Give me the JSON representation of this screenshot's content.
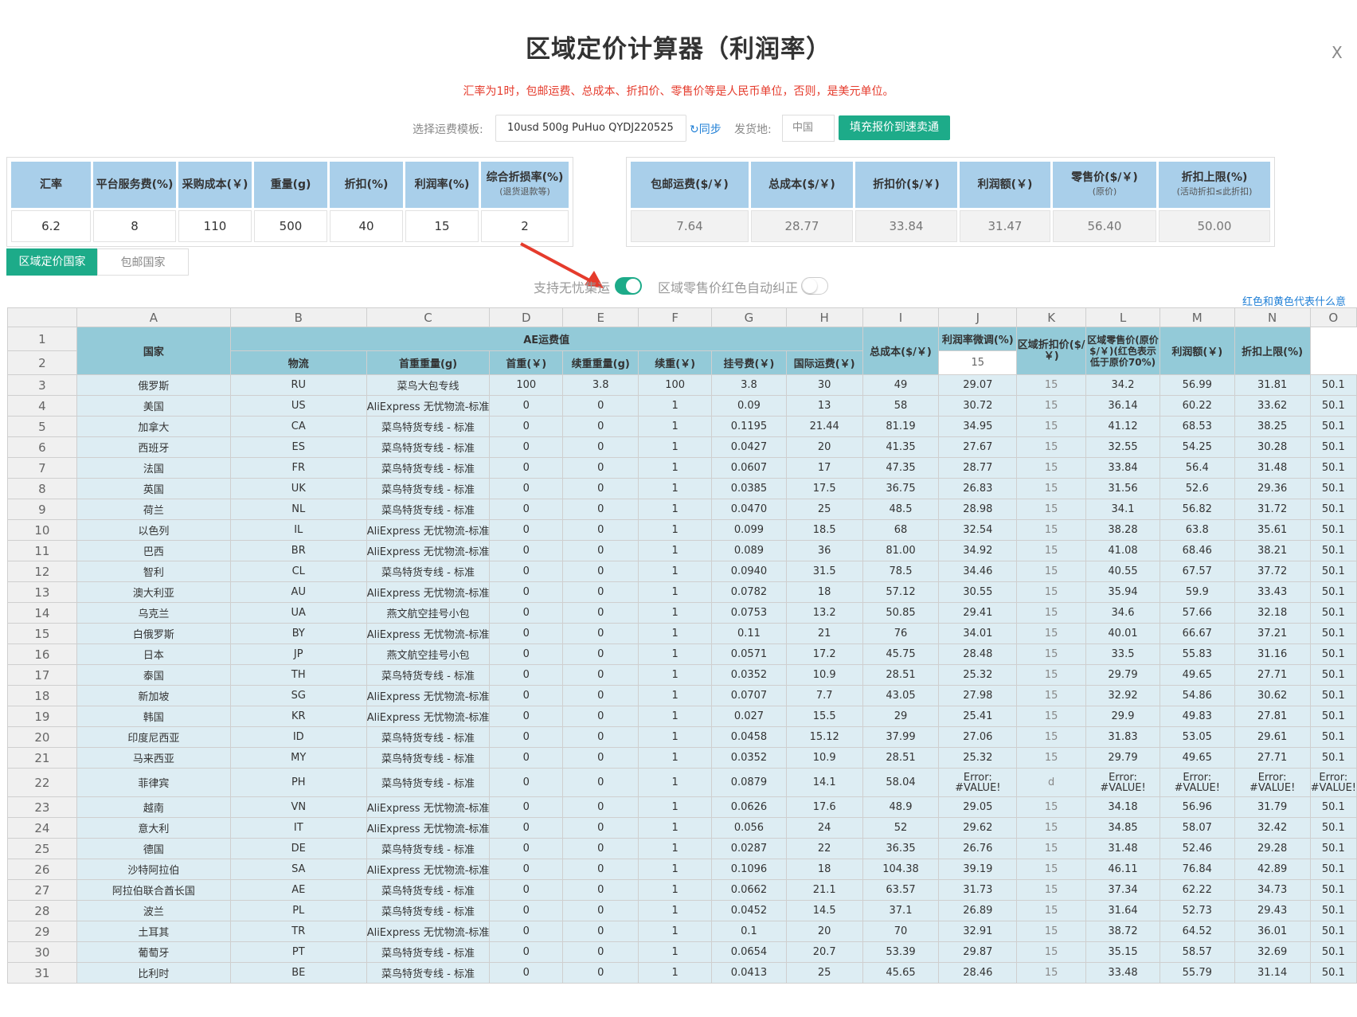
{
  "title": "区域定价计算器（利润率）",
  "close": "X",
  "notice": "汇率为1时，包邮运费、总成本、折扣价、零售价等是人民币单位，否则，是美元单位。",
  "template": {
    "label": "选择运费模板:",
    "selected": "10usd 500g PuHuo QYDJ220525",
    "sync": "↻同步",
    "ship_from_label": "发货地:",
    "ship_from_value": "中国",
    "fill_button": "填充报价到速卖通"
  },
  "inputs": [
    {
      "label": "汇率",
      "sub": "",
      "value": "6.2"
    },
    {
      "label": "平台服务费(%)",
      "sub": "",
      "value": "8"
    },
    {
      "label": "采购成本(￥)",
      "sub": "",
      "value": "110"
    },
    {
      "label": "重量(g)",
      "sub": "",
      "value": "500"
    },
    {
      "label": "折扣(%)",
      "sub": "",
      "value": "40"
    },
    {
      "label": "利润率(%)",
      "sub": "",
      "value": "15"
    },
    {
      "label": "综合折损率(%)",
      "sub": "(退货退款等)",
      "value": "2"
    }
  ],
  "outputs": [
    {
      "label": "包邮运费($/￥)",
      "sub": "",
      "value": "7.64"
    },
    {
      "label": "总成本($/￥)",
      "sub": "",
      "value": "28.77"
    },
    {
      "label": "折扣价($/￥)",
      "sub": "",
      "value": "33.84"
    },
    {
      "label": "利润额(￥)",
      "sub": "",
      "value": "31.47"
    },
    {
      "label": "零售价($/￥)",
      "sub": "(原价)",
      "value": "56.40"
    },
    {
      "label": "折扣上限(%)",
      "sub": "(活动折扣≤此折扣)",
      "value": "50.00"
    }
  ],
  "tabs": {
    "active": "区域定价国家",
    "inactive": "包邮国家"
  },
  "toggles": {
    "wuyou": {
      "label": "支持无忧集运",
      "on": true
    },
    "autofix": {
      "label": "区域零售价红色自动纠正",
      "on": false
    }
  },
  "help_link": "红色和黄色代表什么意思?",
  "colors": {
    "accent": "#1dab89",
    "header": "#93cad8",
    "row": "#ddedf3",
    "notice": "#e53b2c",
    "link": "#1f7fd6"
  },
  "sheet": {
    "col_letters": [
      "A",
      "B",
      "C",
      "D",
      "E",
      "F",
      "G",
      "H",
      "I",
      "J",
      "K",
      "L",
      "M",
      "N",
      "O"
    ],
    "header": {
      "country": "国家",
      "ae_group": "AE运费值",
      "logistics": "物流",
      "first_weight": "首重重量(g)",
      "first_price": "首重(￥)",
      "cont_weight": "续重重量(g)",
      "cont_price": "续重(￥)",
      "reg_fee": "挂号费(￥)",
      "intl_ship": "国际运费(￥)",
      "total_cost": "总成本($/￥)",
      "margin_adj": "利润率微调(%)",
      "margin_adj_value": "15",
      "region_discount": "区域折扣价($/￥)",
      "region_retail": "区域零售价(原价$/￥)(红色表示低于原价70%)",
      "profit": "利润额(￥)",
      "discount_cap": "折扣上限(%)"
    },
    "rows": [
      [
        "俄罗斯",
        "RU",
        "菜鸟大包专线",
        "100",
        "3.8",
        "100",
        "3.8",
        "30",
        "49",
        "29.07",
        "15",
        "34.2",
        "56.99",
        "31.81",
        "50.1"
      ],
      [
        "美国",
        "US",
        "AliExpress 无忧物流-标准",
        "0",
        "0",
        "1",
        "0.09",
        "13",
        "58",
        "30.72",
        "15",
        "36.14",
        "60.22",
        "33.62",
        "50.1"
      ],
      [
        "加拿大",
        "CA",
        "菜鸟特货专线 - 标准",
        "0",
        "0",
        "1",
        "0.1195",
        "21.44",
        "81.19",
        "34.95",
        "15",
        "41.12",
        "68.53",
        "38.25",
        "50.1"
      ],
      [
        "西班牙",
        "ES",
        "菜鸟特货专线 - 标准",
        "0",
        "0",
        "1",
        "0.0427",
        "20",
        "41.35",
        "27.67",
        "15",
        "32.55",
        "54.25",
        "30.28",
        "50.1"
      ],
      [
        "法国",
        "FR",
        "菜鸟特货专线 - 标准",
        "0",
        "0",
        "1",
        "0.0607",
        "17",
        "47.35",
        "28.77",
        "15",
        "33.84",
        "56.4",
        "31.48",
        "50.1"
      ],
      [
        "英国",
        "UK",
        "菜鸟特货专线 - 标准",
        "0",
        "0",
        "1",
        "0.0385",
        "17.5",
        "36.75",
        "26.83",
        "15",
        "31.56",
        "52.6",
        "29.36",
        "50.1"
      ],
      [
        "荷兰",
        "NL",
        "菜鸟特货专线 - 标准",
        "0",
        "0",
        "1",
        "0.0470",
        "25",
        "48.5",
        "28.98",
        "15",
        "34.1",
        "56.82",
        "31.72",
        "50.1"
      ],
      [
        "以色列",
        "IL",
        "AliExpress 无忧物流-标准",
        "0",
        "0",
        "1",
        "0.099",
        "18.5",
        "68",
        "32.54",
        "15",
        "38.28",
        "63.8",
        "35.61",
        "50.1"
      ],
      [
        "巴西",
        "BR",
        "AliExpress 无忧物流-标准",
        "0",
        "0",
        "1",
        "0.089",
        "36",
        "81.00",
        "34.92",
        "15",
        "41.08",
        "68.46",
        "38.21",
        "50.1"
      ],
      [
        "智利",
        "CL",
        "菜鸟特货专线 - 标准",
        "0",
        "0",
        "1",
        "0.0940",
        "31.5",
        "78.5",
        "34.46",
        "15",
        "40.55",
        "67.57",
        "37.72",
        "50.1"
      ],
      [
        "澳大利亚",
        "AU",
        "AliExpress 无忧物流-标准",
        "0",
        "0",
        "1",
        "0.0782",
        "18",
        "57.12",
        "30.55",
        "15",
        "35.94",
        "59.9",
        "33.43",
        "50.1"
      ],
      [
        "乌克兰",
        "UA",
        "燕文航空挂号小包",
        "0",
        "0",
        "1",
        "0.0753",
        "13.2",
        "50.85",
        "29.41",
        "15",
        "34.6",
        "57.66",
        "32.18",
        "50.1"
      ],
      [
        "白俄罗斯",
        "BY",
        "AliExpress 无忧物流-标准",
        "0",
        "0",
        "1",
        "0.11",
        "21",
        "76",
        "34.01",
        "15",
        "40.01",
        "66.67",
        "37.21",
        "50.1"
      ],
      [
        "日本",
        "JP",
        "燕文航空挂号小包",
        "0",
        "0",
        "1",
        "0.0571",
        "17.2",
        "45.75",
        "28.48",
        "15",
        "33.5",
        "55.83",
        "31.16",
        "50.1"
      ],
      [
        "泰国",
        "TH",
        "菜鸟特货专线 - 标准",
        "0",
        "0",
        "1",
        "0.0352",
        "10.9",
        "28.51",
        "25.32",
        "15",
        "29.79",
        "49.65",
        "27.71",
        "50.1"
      ],
      [
        "新加坡",
        "SG",
        "AliExpress 无忧物流-标准",
        "0",
        "0",
        "1",
        "0.0707",
        "7.7",
        "43.05",
        "27.98",
        "15",
        "32.92",
        "54.86",
        "30.62",
        "50.1"
      ],
      [
        "韩国",
        "KR",
        "AliExpress 无忧物流-标准",
        "0",
        "0",
        "1",
        "0.027",
        "15.5",
        "29",
        "25.41",
        "15",
        "29.9",
        "49.83",
        "27.81",
        "50.1"
      ],
      [
        "印度尼西亚",
        "ID",
        "菜鸟特货专线 - 标准",
        "0",
        "0",
        "1",
        "0.0458",
        "15.12",
        "37.99",
        "27.06",
        "15",
        "31.83",
        "53.05",
        "29.61",
        "50.1"
      ],
      [
        "马来西亚",
        "MY",
        "菜鸟特货专线 - 标准",
        "0",
        "0",
        "1",
        "0.0352",
        "10.9",
        "28.51",
        "25.32",
        "15",
        "29.79",
        "49.65",
        "27.71",
        "50.1"
      ],
      [
        "菲律宾",
        "PH",
        "菜鸟特货专线 - 标准",
        "0",
        "0",
        "1",
        "0.0879",
        "14.1",
        "58.04",
        "Error: #VALUE!",
        "d",
        "Error: #VALUE!",
        "Error: #VALUE!",
        "Error: #VALUE!",
        "Error: #VALUE!"
      ],
      [
        "越南",
        "VN",
        "AliExpress 无忧物流-标准",
        "0",
        "0",
        "1",
        "0.0626",
        "17.6",
        "48.9",
        "29.05",
        "15",
        "34.18",
        "56.96",
        "31.79",
        "50.1"
      ],
      [
        "意大利",
        "IT",
        "AliExpress 无忧物流-标准",
        "0",
        "0",
        "1",
        "0.056",
        "24",
        "52",
        "29.62",
        "15",
        "34.85",
        "58.07",
        "32.42",
        "50.1"
      ],
      [
        "德国",
        "DE",
        "菜鸟特货专线 - 标准",
        "0",
        "0",
        "1",
        "0.0287",
        "22",
        "36.35",
        "26.76",
        "15",
        "31.48",
        "52.46",
        "29.28",
        "50.1"
      ],
      [
        "沙特阿拉伯",
        "SA",
        "AliExpress 无忧物流-标准",
        "0",
        "0",
        "1",
        "0.1096",
        "18",
        "104.38",
        "39.19",
        "15",
        "46.11",
        "76.84",
        "42.89",
        "50.1"
      ],
      [
        "阿拉伯联合酋长国",
        "AE",
        "菜鸟特货专线 - 标准",
        "0",
        "0",
        "1",
        "0.0662",
        "21.1",
        "63.57",
        "31.73",
        "15",
        "37.34",
        "62.22",
        "34.73",
        "50.1"
      ],
      [
        "波兰",
        "PL",
        "菜鸟特货专线 - 标准",
        "0",
        "0",
        "1",
        "0.0452",
        "14.5",
        "37.1",
        "26.89",
        "15",
        "31.64",
        "52.73",
        "29.43",
        "50.1"
      ],
      [
        "土耳其",
        "TR",
        "AliExpress 无忧物流-标准",
        "0",
        "0",
        "1",
        "0.1",
        "20",
        "70",
        "32.91",
        "15",
        "38.72",
        "64.52",
        "36.01",
        "50.1"
      ],
      [
        "葡萄牙",
        "PT",
        "菜鸟特货专线 - 标准",
        "0",
        "0",
        "1",
        "0.0654",
        "20.7",
        "53.39",
        "29.87",
        "15",
        "35.15",
        "58.57",
        "32.69",
        "50.1"
      ],
      [
        "比利时",
        "BE",
        "菜鸟特货专线 - 标准",
        "0",
        "0",
        "1",
        "0.0413",
        "25",
        "45.65",
        "28.46",
        "15",
        "33.48",
        "55.79",
        "31.14",
        "50.1"
      ]
    ]
  }
}
